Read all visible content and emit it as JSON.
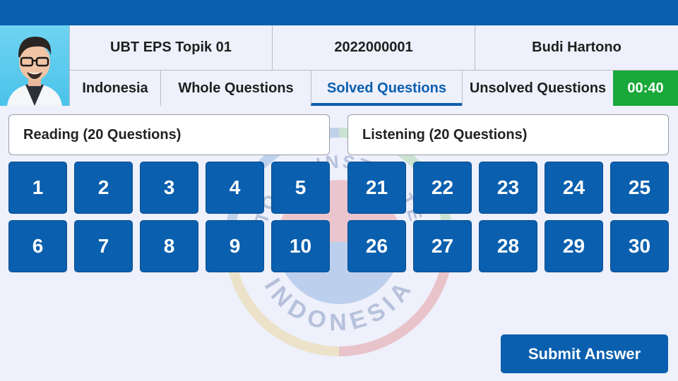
{
  "header": {
    "exam_title": "UBT EPS Topik 01",
    "candidate_id": "2022000001",
    "candidate_name": "Budi Hartono"
  },
  "tabs": [
    {
      "label": "Indonesia"
    },
    {
      "label": "Whole Questions"
    },
    {
      "label": "Solved Questions",
      "active": true
    },
    {
      "label": "Unsolved Questions"
    }
  ],
  "timer": "00:40",
  "sections": {
    "reading": "Reading (20 Questions)",
    "listening": "Listening (20 Questions)"
  },
  "questions": {
    "reading": [
      "1",
      "2",
      "3",
      "4",
      "5",
      "6",
      "7",
      "8",
      "9",
      "10"
    ],
    "listening": [
      "21",
      "22",
      "23",
      "24",
      "25",
      "26",
      "27",
      "28",
      "29",
      "30"
    ]
  },
  "submit_label": "Submit Answer",
  "watermark": {
    "top_text": "TOPIK INSTITUTE",
    "bottom_text": "INDONESIA"
  },
  "colors": {
    "primary": "#0a5fae",
    "timer_bg": "#19a83a",
    "background": "#eef0fb"
  }
}
